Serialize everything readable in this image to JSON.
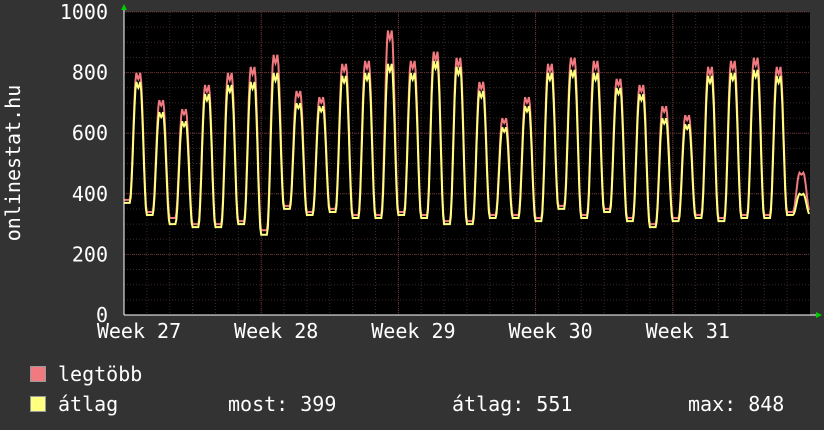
{
  "chart_data": {
    "type": "line",
    "ylabel": "onlinestat.hu",
    "ylim": [
      0,
      1000
    ],
    "yticks": [
      0,
      200,
      400,
      600,
      800,
      1000
    ],
    "xtick_labels": [
      "Week 27",
      "Week 28",
      "Week 29",
      "Week 30",
      "Week 31"
    ],
    "grid": true,
    "series": [
      {
        "name": "legtöbb",
        "color": "#f07a80",
        "daily_peaks": [
          800,
          710,
          680,
          760,
          800,
          820,
          860,
          740,
          720,
          830,
          840,
          940,
          840,
          870,
          850,
          770,
          650,
          720,
          830,
          850,
          840,
          780,
          760,
          690,
          660,
          820,
          840,
          850,
          820,
          470
        ],
        "daily_troughs": [
          380,
          340,
          320,
          300,
          300,
          310,
          280,
          360,
          340,
          350,
          330,
          330,
          340,
          330,
          310,
          310,
          330,
          330,
          320,
          360,
          330,
          350,
          320,
          300,
          320,
          330,
          320,
          330,
          330,
          340
        ]
      },
      {
        "name": "átlag",
        "color": "#ffff80",
        "daily_peaks": [
          770,
          670,
          640,
          730,
          760,
          770,
          800,
          700,
          690,
          790,
          800,
          830,
          800,
          840,
          820,
          740,
          620,
          690,
          800,
          810,
          800,
          750,
          730,
          650,
          630,
          790,
          800,
          810,
          790,
          400
        ],
        "daily_troughs": [
          370,
          330,
          300,
          290,
          290,
          300,
          265,
          350,
          330,
          340,
          320,
          320,
          330,
          320,
          300,
          300,
          320,
          320,
          310,
          350,
          320,
          340,
          310,
          290,
          310,
          320,
          310,
          320,
          320,
          330
        ]
      }
    ]
  },
  "legend": {
    "series1_label": "legtöbb",
    "series2_label": "átlag"
  },
  "stats": {
    "current": "most: 399",
    "average": "átlag: 551",
    "max": "max: 848"
  }
}
